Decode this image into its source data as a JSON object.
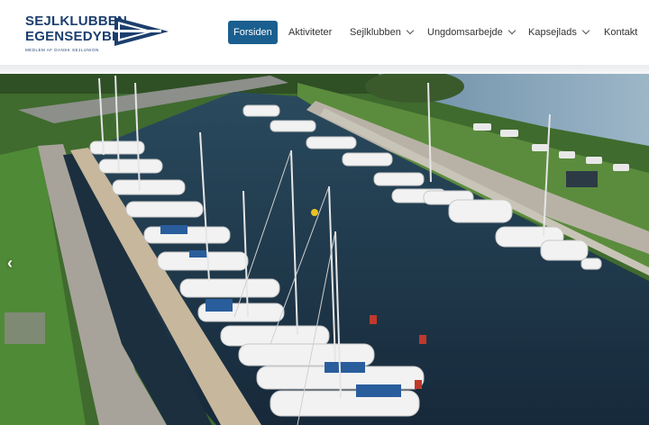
{
  "logo": {
    "line1": "SEJLKLUBBEN",
    "line2": "EGENSEDYBET",
    "tagline": "MEDLEM AF DANSK SEJLUNION"
  },
  "nav": {
    "items": [
      {
        "label": "Forsiden",
        "active": true,
        "dropdown": false
      },
      {
        "label": "Aktiviteter",
        "active": false,
        "dropdown": false
      },
      {
        "label": "Sejlklubben",
        "active": false,
        "dropdown": true
      },
      {
        "label": "Ungdomsarbejde",
        "active": false,
        "dropdown": true
      },
      {
        "label": "Kapsejlads",
        "active": false,
        "dropdown": true
      },
      {
        "label": "Kontakt",
        "active": false,
        "dropdown": false
      }
    ]
  },
  "slider": {
    "prev_icon": "chevron-left-icon"
  },
  "colors": {
    "brand": "#1c3f6e",
    "active_nav": "#1a5f8f",
    "water": "#1d3446",
    "grass": "#4f8a36"
  }
}
